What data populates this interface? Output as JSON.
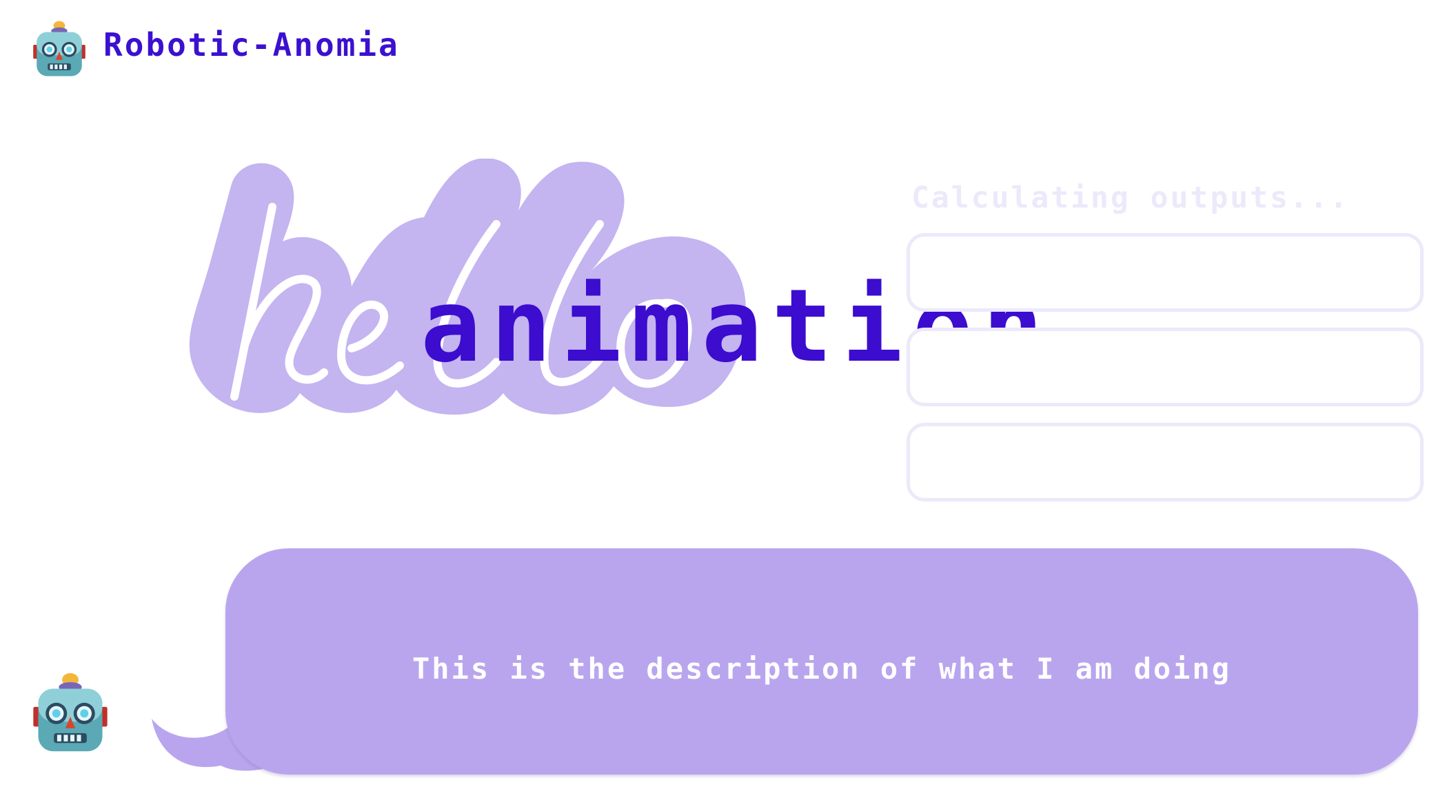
{
  "header": {
    "app_title": "Robotic-Anomia",
    "logo_icon": "robot-face-icon"
  },
  "hero": {
    "hello_word": "hello",
    "animation_text": "animation..."
  },
  "outputs": {
    "label": "Calculating outputs...",
    "boxes": [
      "",
      "",
      ""
    ]
  },
  "chat": {
    "avatar_icon": "robot-face-icon",
    "message": "This is the description of what I am doing"
  },
  "colors": {
    "accent": "#3c10d0",
    "bubble": "#b9a5ee",
    "hello_fill": "#c4b4f0",
    "faded_outline": "#ece9fb"
  }
}
